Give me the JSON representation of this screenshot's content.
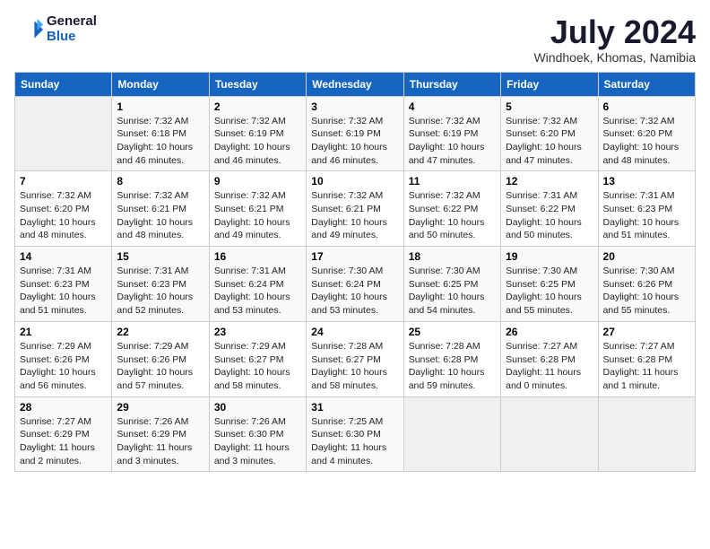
{
  "app": {
    "logo_line1": "General",
    "logo_line2": "Blue"
  },
  "header": {
    "title": "July 2024",
    "subtitle": "Windhoek, Khomas, Namibia"
  },
  "weekdays": [
    "Sunday",
    "Monday",
    "Tuesday",
    "Wednesday",
    "Thursday",
    "Friday",
    "Saturday"
  ],
  "weeks": [
    [
      {
        "day": "",
        "info": ""
      },
      {
        "day": "1",
        "info": "Sunrise: 7:32 AM\nSunset: 6:18 PM\nDaylight: 10 hours\nand 46 minutes."
      },
      {
        "day": "2",
        "info": "Sunrise: 7:32 AM\nSunset: 6:19 PM\nDaylight: 10 hours\nand 46 minutes."
      },
      {
        "day": "3",
        "info": "Sunrise: 7:32 AM\nSunset: 6:19 PM\nDaylight: 10 hours\nand 46 minutes."
      },
      {
        "day": "4",
        "info": "Sunrise: 7:32 AM\nSunset: 6:19 PM\nDaylight: 10 hours\nand 47 minutes."
      },
      {
        "day": "5",
        "info": "Sunrise: 7:32 AM\nSunset: 6:20 PM\nDaylight: 10 hours\nand 47 minutes."
      },
      {
        "day": "6",
        "info": "Sunrise: 7:32 AM\nSunset: 6:20 PM\nDaylight: 10 hours\nand 48 minutes."
      }
    ],
    [
      {
        "day": "7",
        "info": "Sunrise: 7:32 AM\nSunset: 6:20 PM\nDaylight: 10 hours\nand 48 minutes."
      },
      {
        "day": "8",
        "info": "Sunrise: 7:32 AM\nSunset: 6:21 PM\nDaylight: 10 hours\nand 48 minutes."
      },
      {
        "day": "9",
        "info": "Sunrise: 7:32 AM\nSunset: 6:21 PM\nDaylight: 10 hours\nand 49 minutes."
      },
      {
        "day": "10",
        "info": "Sunrise: 7:32 AM\nSunset: 6:21 PM\nDaylight: 10 hours\nand 49 minutes."
      },
      {
        "day": "11",
        "info": "Sunrise: 7:32 AM\nSunset: 6:22 PM\nDaylight: 10 hours\nand 50 minutes."
      },
      {
        "day": "12",
        "info": "Sunrise: 7:31 AM\nSunset: 6:22 PM\nDaylight: 10 hours\nand 50 minutes."
      },
      {
        "day": "13",
        "info": "Sunrise: 7:31 AM\nSunset: 6:23 PM\nDaylight: 10 hours\nand 51 minutes."
      }
    ],
    [
      {
        "day": "14",
        "info": "Sunrise: 7:31 AM\nSunset: 6:23 PM\nDaylight: 10 hours\nand 51 minutes."
      },
      {
        "day": "15",
        "info": "Sunrise: 7:31 AM\nSunset: 6:23 PM\nDaylight: 10 hours\nand 52 minutes."
      },
      {
        "day": "16",
        "info": "Sunrise: 7:31 AM\nSunset: 6:24 PM\nDaylight: 10 hours\nand 53 minutes."
      },
      {
        "day": "17",
        "info": "Sunrise: 7:30 AM\nSunset: 6:24 PM\nDaylight: 10 hours\nand 53 minutes."
      },
      {
        "day": "18",
        "info": "Sunrise: 7:30 AM\nSunset: 6:25 PM\nDaylight: 10 hours\nand 54 minutes."
      },
      {
        "day": "19",
        "info": "Sunrise: 7:30 AM\nSunset: 6:25 PM\nDaylight: 10 hours\nand 55 minutes."
      },
      {
        "day": "20",
        "info": "Sunrise: 7:30 AM\nSunset: 6:26 PM\nDaylight: 10 hours\nand 55 minutes."
      }
    ],
    [
      {
        "day": "21",
        "info": "Sunrise: 7:29 AM\nSunset: 6:26 PM\nDaylight: 10 hours\nand 56 minutes."
      },
      {
        "day": "22",
        "info": "Sunrise: 7:29 AM\nSunset: 6:26 PM\nDaylight: 10 hours\nand 57 minutes."
      },
      {
        "day": "23",
        "info": "Sunrise: 7:29 AM\nSunset: 6:27 PM\nDaylight: 10 hours\nand 58 minutes."
      },
      {
        "day": "24",
        "info": "Sunrise: 7:28 AM\nSunset: 6:27 PM\nDaylight: 10 hours\nand 58 minutes."
      },
      {
        "day": "25",
        "info": "Sunrise: 7:28 AM\nSunset: 6:28 PM\nDaylight: 10 hours\nand 59 minutes."
      },
      {
        "day": "26",
        "info": "Sunrise: 7:27 AM\nSunset: 6:28 PM\nDaylight: 11 hours\nand 0 minutes."
      },
      {
        "day": "27",
        "info": "Sunrise: 7:27 AM\nSunset: 6:28 PM\nDaylight: 11 hours\nand 1 minute."
      }
    ],
    [
      {
        "day": "28",
        "info": "Sunrise: 7:27 AM\nSunset: 6:29 PM\nDaylight: 11 hours\nand 2 minutes."
      },
      {
        "day": "29",
        "info": "Sunrise: 7:26 AM\nSunset: 6:29 PM\nDaylight: 11 hours\nand 3 minutes."
      },
      {
        "day": "30",
        "info": "Sunrise: 7:26 AM\nSunset: 6:30 PM\nDaylight: 11 hours\nand 3 minutes."
      },
      {
        "day": "31",
        "info": "Sunrise: 7:25 AM\nSunset: 6:30 PM\nDaylight: 11 hours\nand 4 minutes."
      },
      {
        "day": "",
        "info": ""
      },
      {
        "day": "",
        "info": ""
      },
      {
        "day": "",
        "info": ""
      }
    ]
  ]
}
